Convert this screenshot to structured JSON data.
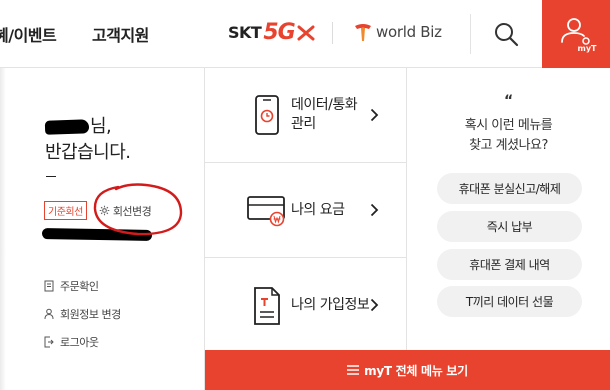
{
  "header": {
    "nav_events": "혜/이벤트",
    "nav_support": "고객지원",
    "brand_skt": "SKT",
    "brand_5g": "5G",
    "brand_worldbiz": "world Biz",
    "myt_label": "myT"
  },
  "profile": {
    "greeting_suffix": "님,",
    "greeting_line2": "반갑습니다.",
    "line_badge": "기준회선",
    "change_line": "회선변경",
    "links": [
      {
        "label": "주문확인",
        "icon": "receipt-icon"
      },
      {
        "label": "회원정보 변경",
        "icon": "person-icon"
      },
      {
        "label": "로그아웃",
        "icon": "logout-icon"
      }
    ]
  },
  "menu": [
    {
      "label": "데이터/통화 관리",
      "icon": "phone-clock-icon"
    },
    {
      "label": "나의 요금",
      "icon": "card-won-icon"
    },
    {
      "label": "나의 가입정보",
      "icon": "document-t-icon"
    }
  ],
  "suggest": {
    "quote": "“",
    "title_line1": "혹시 이런 메뉴를",
    "title_line2": "찾고 계셨나요?",
    "items": [
      "휴대폰 분실신고/해제",
      "즉시 납부",
      "휴대폰 결제 내역",
      "T끼리 데이터 선물"
    ]
  },
  "bottom": {
    "label": "myT 전체 메뉴 보기"
  },
  "colors": {
    "accent": "#e8432e",
    "pill_bg": "#f1f1f1"
  }
}
